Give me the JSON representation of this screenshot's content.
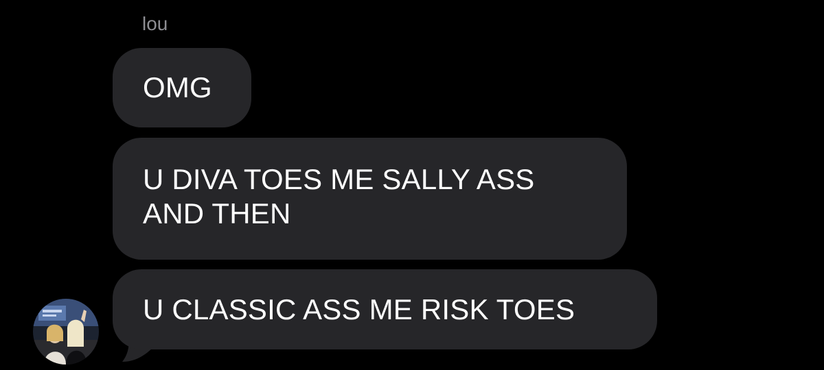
{
  "conversation": {
    "sender_name": "lou",
    "messages": [
      {
        "lines": [
          "OMG"
        ]
      },
      {
        "lines": [
          "U DIVA TOES ME SALLY ASS",
          "AND THEN"
        ]
      },
      {
        "lines": [
          "U CLASSIC ASS ME RISK TOES"
        ]
      }
    ]
  },
  "avatar": {
    "icon": "contact-photo-icon"
  },
  "colors": {
    "background": "#000000",
    "bubble": "#262629",
    "text": "#ffffff",
    "sender_label": "#8e8e93"
  }
}
